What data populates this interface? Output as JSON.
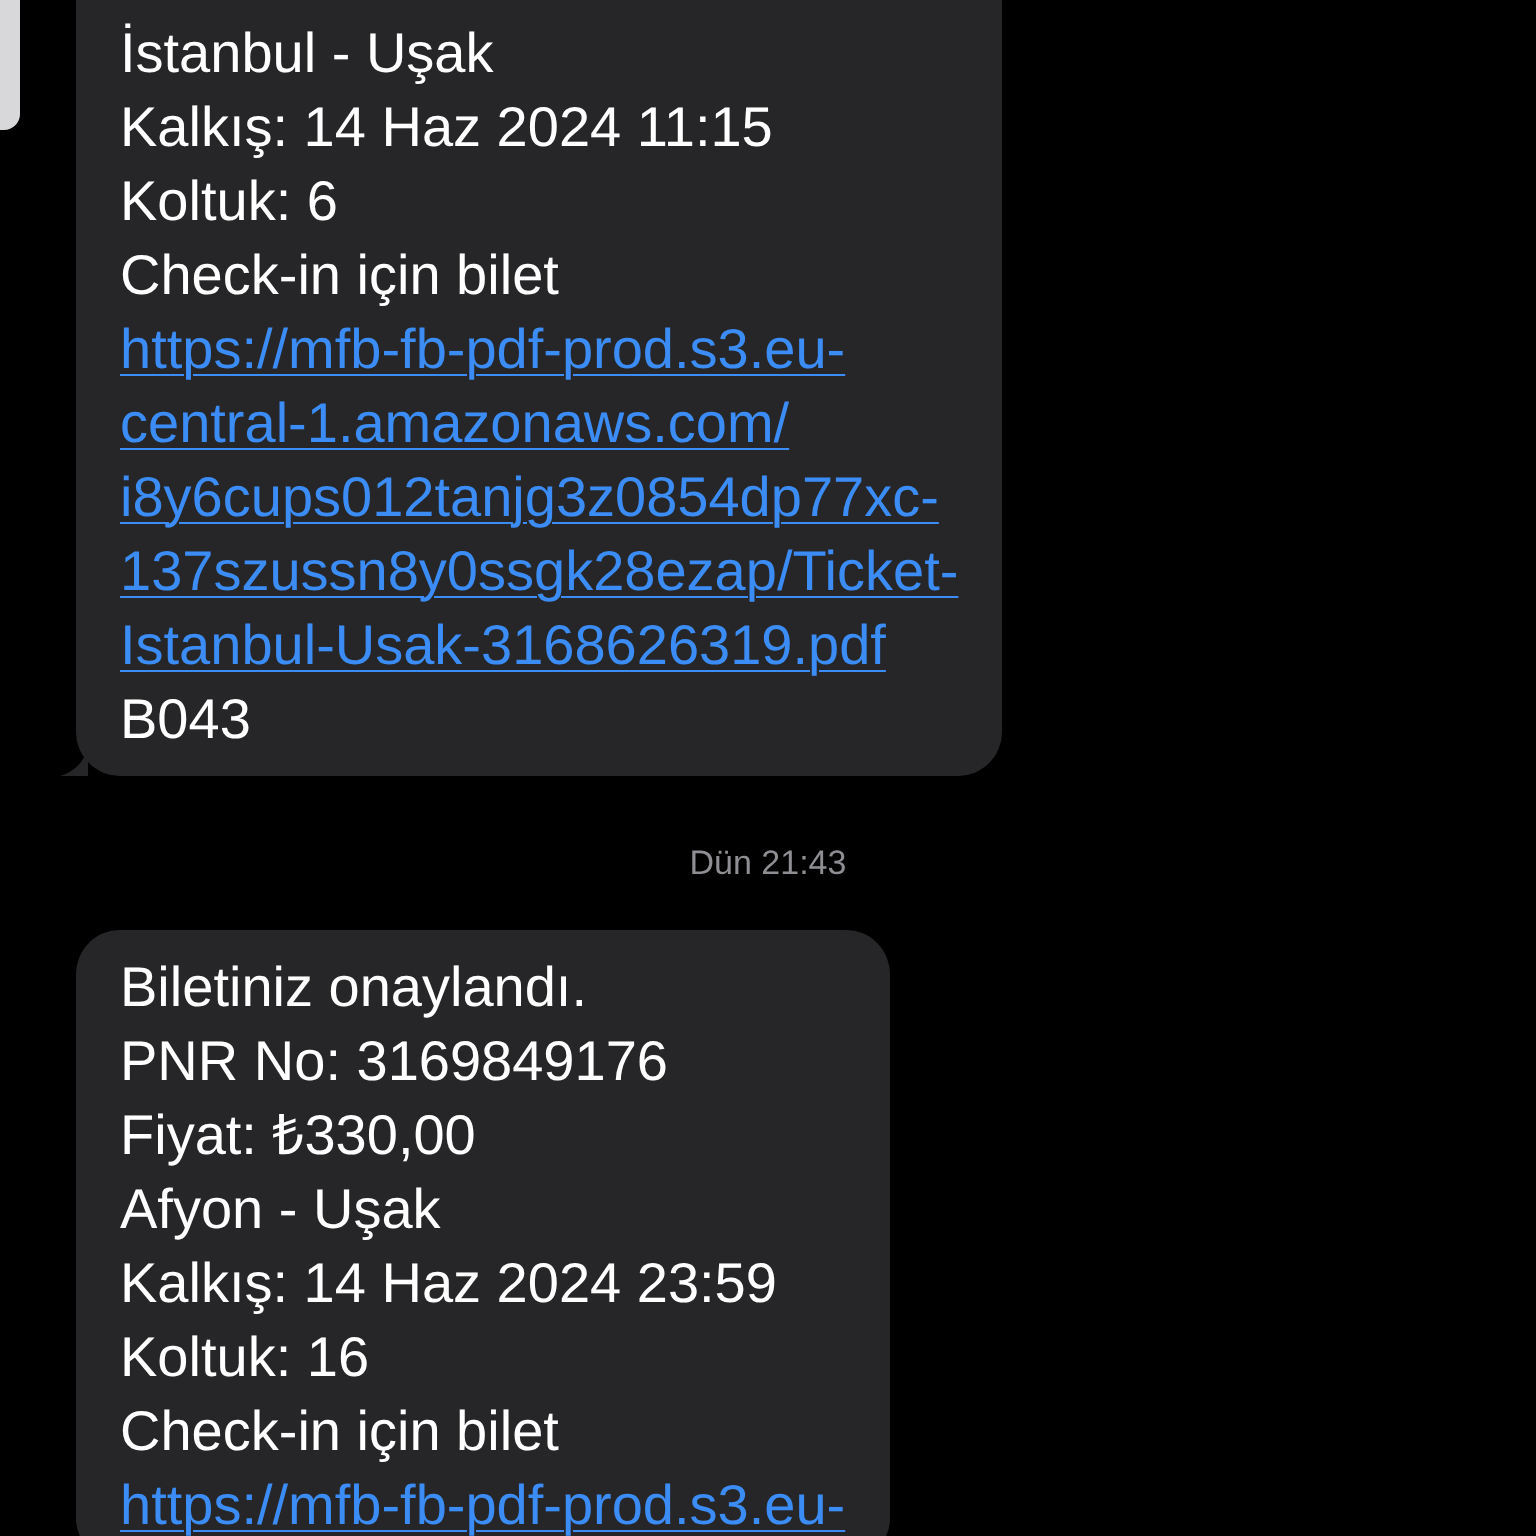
{
  "thread": [
    {
      "kind": "bubble",
      "tail": true,
      "lines": [
        {
          "kind": "text",
          "text": "İstanbul - Uşak"
        },
        {
          "kind": "text",
          "text": "Kalkış: 14 Haz 2024 11:15"
        },
        {
          "kind": "text",
          "text": "Koltuk: 6"
        },
        {
          "kind": "text",
          "text": "Check-in için bilet"
        },
        {
          "kind": "link",
          "text": "https://mfb-fb-pdf-prod.s3.eu-"
        },
        {
          "kind": "link",
          "text": "central-1.amazonaws.com/"
        },
        {
          "kind": "link",
          "text": "i8y6cups012tanjg3z0854dp77xc-"
        },
        {
          "kind": "link",
          "text": "137szussn8y0ssgk28ezap/Ticket-"
        },
        {
          "kind": "link",
          "text": "Istanbul-Usak-3168626319.pdf"
        },
        {
          "kind": "text",
          "text": "B043"
        }
      ]
    },
    {
      "kind": "timestamp",
      "text": "Dün 21:43"
    },
    {
      "kind": "bubble",
      "lines": [
        {
          "kind": "text",
          "text": "Biletiniz onaylandı."
        },
        {
          "kind": "text",
          "text": "PNR No: 3169849176"
        },
        {
          "kind": "text",
          "text": "Fiyat: ₺330,00"
        },
        {
          "kind": "text",
          "text": "Afyon - Uşak"
        },
        {
          "kind": "text",
          "text": "Kalkış: 14 Haz 2024 23:59"
        },
        {
          "kind": "text",
          "text": "Koltuk: 16"
        },
        {
          "kind": "text",
          "text": "Check-in için bilet"
        },
        {
          "kind": "link",
          "text": "https://mfb-fb-pdf-prod.s3.eu-"
        }
      ]
    }
  ]
}
